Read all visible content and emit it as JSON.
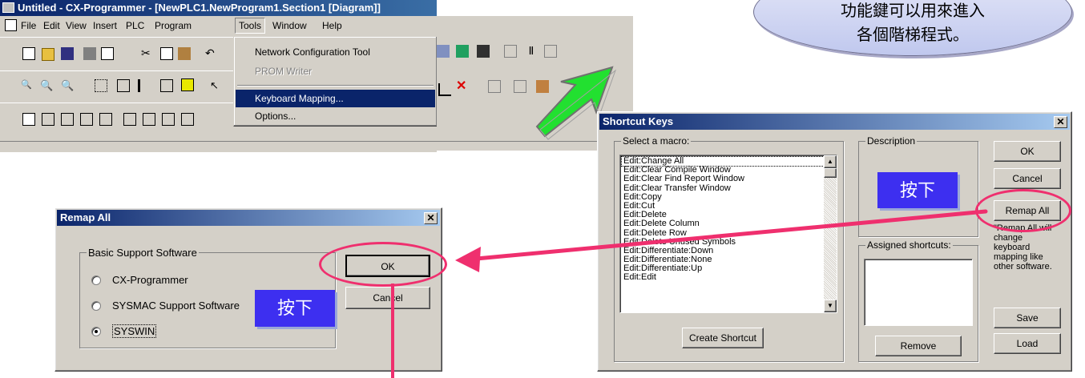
{
  "cxp": {
    "title": "Untitled - CX-Programmer - [NewPLC1.NewProgram1.Section1 [Diagram]]",
    "menu": [
      "File",
      "Edit",
      "View",
      "Insert",
      "PLC",
      "Program",
      "Tools",
      "Window",
      "Help"
    ],
    "tools_menu": [
      "Network Configuration Tool",
      "PROM Writer",
      "Keyboard Mapping...",
      "Options..."
    ]
  },
  "note": {
    "line1": "功能鍵可以用來進入",
    "line2": "各個階梯程式。"
  },
  "shortcut": {
    "title": "Shortcut Keys",
    "select_label": "Select a macro:",
    "macros": [
      "Edit:Change All",
      "Edit:Clear Compile Window",
      "Edit:Clear Find Report Window",
      "Edit:Clear Transfer Window",
      "Edit:Copy",
      "Edit:Cut",
      "Edit:Delete",
      "Edit:Delete Column",
      "Edit:Delete Row",
      "Edit:Delete Unused Symbols",
      "Edit:Differentiate:Down",
      "Edit:Differentiate:None",
      "Edit:Differentiate:Up",
      "Edit:Edit"
    ],
    "description_label": "Description",
    "assigned_label": "Assigned shortcuts:",
    "remap_help": "\"Remap All will change keyboard mapping like other software.",
    "buttons": {
      "ok": "OK",
      "cancel": "Cancel",
      "remap_all": "Remap All",
      "save": "Save",
      "load": "Load",
      "create_shortcut": "Create Shortcut",
      "remove": "Remove"
    }
  },
  "remap": {
    "title": "Remap All",
    "group_label": "Basic Support Software",
    "options": [
      "CX-Programmer",
      "SYSMAC Support Software",
      "SYSWIN"
    ],
    "selected": "SYSWIN",
    "ok": "OK",
    "cancel": "Cancel"
  },
  "callouts": {
    "press1": "按下",
    "press2": "按下"
  },
  "colors": {
    "titlebar": "#0a246a",
    "callout": "#3d2ff0",
    "arrow": "#22e030",
    "highlight": "#ef2f6e"
  }
}
